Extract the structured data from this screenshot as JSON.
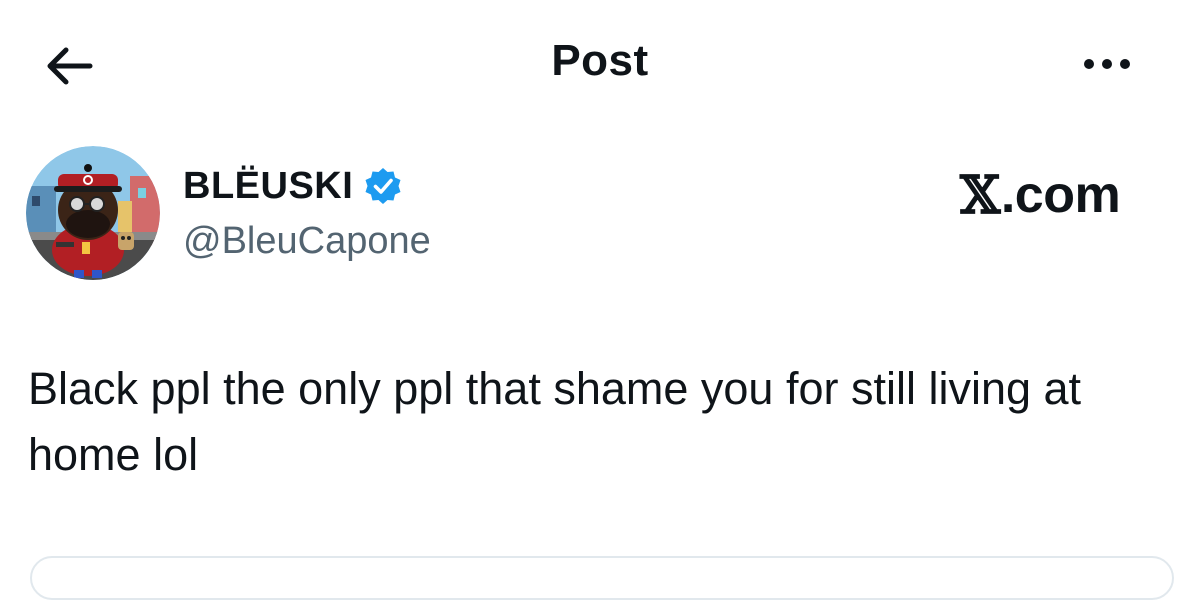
{
  "header": {
    "title": "Post",
    "back_icon": "back-arrow-icon",
    "more_icon": "more-horizontal-icon"
  },
  "author": {
    "display_name": "BLËUSKI",
    "handle": "@BleuCapone",
    "verified": true,
    "verified_icon": "verified-badge-icon"
  },
  "source": {
    "label": ".com"
  },
  "post": {
    "text": "Black ppl the only ppl that shame you for still living at home lol"
  },
  "colors": {
    "text": "#0f1419",
    "secondary": "#536471",
    "verified": "#1d9bf0",
    "border": "#e1e8ed"
  }
}
